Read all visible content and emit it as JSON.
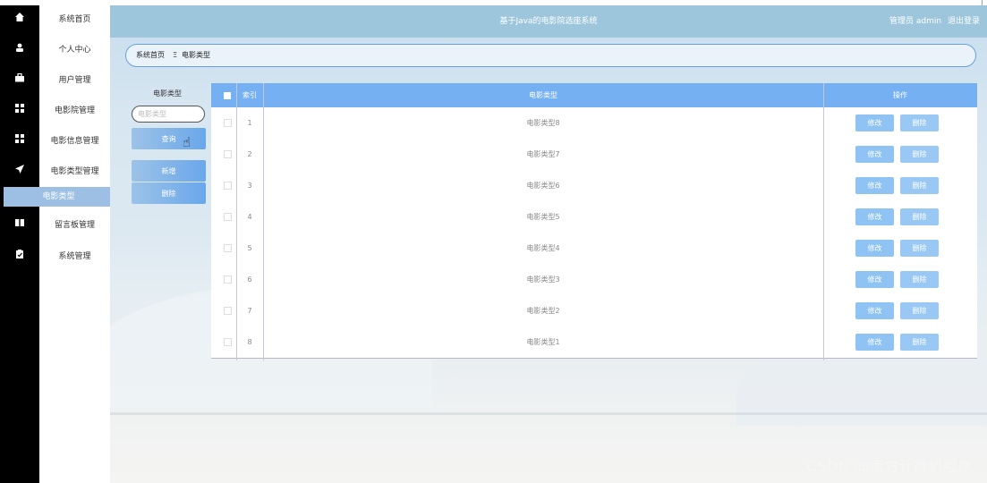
{
  "app": {
    "title": "基于Java的电影院选座系统",
    "user": "管理员 admin",
    "logout": "退出登录"
  },
  "rail_icons": [
    "home-icon",
    "user-icon",
    "briefcase-icon",
    "grid-icon",
    "grid-icon",
    "send-icon",
    "",
    "book-icon",
    "clipboard-icon"
  ],
  "sidebar": {
    "items": [
      {
        "label": "系统首页",
        "icon": "home-icon"
      },
      {
        "label": "个人中心",
        "icon": "user-icon"
      },
      {
        "label": "用户管理",
        "icon": "briefcase-icon"
      },
      {
        "label": "电影院管理",
        "icon": "grid-icon"
      },
      {
        "label": "电影信息管理",
        "icon": "grid-icon"
      },
      {
        "label": "电影类型管理",
        "icon": "send-icon"
      },
      {
        "label": "电影类型",
        "icon": "",
        "active": true
      },
      {
        "label": "留言板管理",
        "icon": "book-icon"
      },
      {
        "label": "系统管理",
        "icon": "clipboard-icon"
      }
    ]
  },
  "breadcrumb": {
    "home": "系统首页",
    "sep": "Ξ",
    "current": "电影类型"
  },
  "search": {
    "label": "电影类型",
    "placeholder": "电影类型",
    "query_btn": "查询",
    "add_btn": "新增",
    "delete_btn": "删除"
  },
  "table": {
    "headers": {
      "index": "索引",
      "type": "电影类型",
      "action": "操作"
    },
    "rows": [
      {
        "index": "1",
        "type": "电影类型8"
      },
      {
        "index": "2",
        "type": "电影类型7"
      },
      {
        "index": "3",
        "type": "电影类型6"
      },
      {
        "index": "4",
        "type": "电影类型5"
      },
      {
        "index": "5",
        "type": "电影类型4"
      },
      {
        "index": "6",
        "type": "电影类型3"
      },
      {
        "index": "7",
        "type": "电影类型2"
      },
      {
        "index": "8",
        "type": "电影类型1"
      }
    ],
    "edit_label": "修改",
    "delete_label": "删除"
  },
  "watermark": "CSDN @南方计算机程序",
  "colors": {
    "rail": "#000000",
    "header": "#9dc6dd",
    "active": "#9dbfe3",
    "table_header": "#74b0f2",
    "button": "#8ec3f4"
  }
}
